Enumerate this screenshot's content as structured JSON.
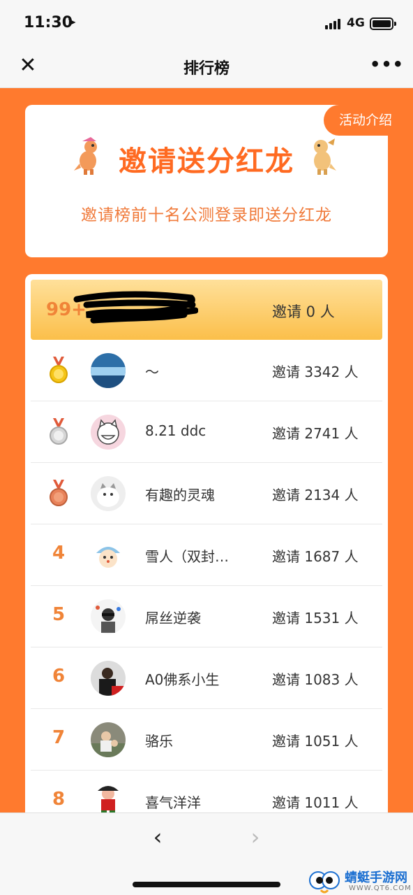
{
  "status_bar": {
    "time": "11:30",
    "network": "4G"
  },
  "nav": {
    "title": "排行榜",
    "close_icon": "close-icon",
    "more_icon": "more-icon"
  },
  "banner": {
    "activity_tag": "活动介绍",
    "title": "邀请送分红龙",
    "subtitle": "邀请榜前十名公测登录即送分红龙"
  },
  "my_entry": {
    "rank": "99+",
    "count": "邀请 0 人"
  },
  "leaderboard": [
    {
      "rank": "1",
      "name": "～",
      "count": "邀请 3342 人",
      "medal": "gold"
    },
    {
      "rank": "2",
      "name": "8.21 ddc",
      "count": "邀请 2741 人",
      "medal": "silver"
    },
    {
      "rank": "3",
      "name": "有趣的灵魂",
      "count": "邀请 2134 人",
      "medal": "bronze"
    },
    {
      "rank": "4",
      "name": "雪人（双封…",
      "count": "邀请 1687 人"
    },
    {
      "rank": "5",
      "name": "屌丝逆袭",
      "count": "邀请 1531 人"
    },
    {
      "rank": "6",
      "name": "A0佛系小生",
      "count": "邀请 1083 人"
    },
    {
      "rank": "7",
      "name": "骆乐",
      "count": "邀请 1051 人"
    },
    {
      "rank": "8",
      "name": "喜气洋洋",
      "count": "邀请 1011 人"
    }
  ],
  "toolbar": {
    "back_icon": "chevron-left-icon",
    "forward_icon": "chevron-right-icon"
  },
  "watermark": {
    "name": "蜻蜓手游网",
    "url": "WWW.QT6.COM"
  },
  "colors": {
    "brand_orange": "#ff7a2e",
    "rank_orange": "#f08438",
    "highlight": "#fbbf4a"
  }
}
